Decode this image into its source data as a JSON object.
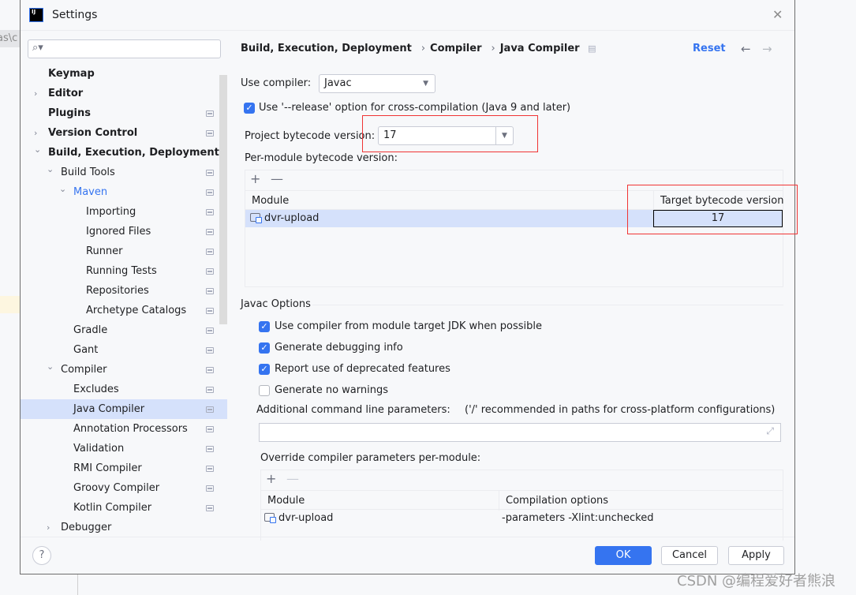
{
  "background": {
    "tab_fragment": "as\\c"
  },
  "window": {
    "title": "Settings",
    "icon_text": "IJ"
  },
  "search": {
    "placeholder": ""
  },
  "tree": [
    {
      "label": "Keymap",
      "level": 0,
      "bold": true,
      "chevron": "",
      "settings": false
    },
    {
      "label": "Editor",
      "level": 0,
      "bold": true,
      "chevron": "right",
      "settings": false
    },
    {
      "label": "Plugins",
      "level": 0,
      "bold": true,
      "chevron": "",
      "settings": true
    },
    {
      "label": "Version Control",
      "level": 0,
      "bold": true,
      "chevron": "right",
      "settings": true
    },
    {
      "label": "Build, Execution, Deployment",
      "level": 0,
      "bold": true,
      "chevron": "down",
      "settings": false
    },
    {
      "label": "Build Tools",
      "level": 1,
      "bold": false,
      "chevron": "down",
      "settings": true
    },
    {
      "label": "Maven",
      "level": 2,
      "bold": false,
      "chevron": "down",
      "settings": true,
      "color": "#3574f0"
    },
    {
      "label": "Importing",
      "level": 3,
      "bold": false,
      "chevron": "",
      "settings": true
    },
    {
      "label": "Ignored Files",
      "level": 3,
      "bold": false,
      "chevron": "",
      "settings": true
    },
    {
      "label": "Runner",
      "level": 3,
      "bold": false,
      "chevron": "",
      "settings": true
    },
    {
      "label": "Running Tests",
      "level": 3,
      "bold": false,
      "chevron": "",
      "settings": true
    },
    {
      "label": "Repositories",
      "level": 3,
      "bold": false,
      "chevron": "",
      "settings": true
    },
    {
      "label": "Archetype Catalogs",
      "level": 3,
      "bold": false,
      "chevron": "",
      "settings": true
    },
    {
      "label": "Gradle",
      "level": 2,
      "bold": false,
      "chevron": "",
      "settings": true
    },
    {
      "label": "Gant",
      "level": 2,
      "bold": false,
      "chevron": "",
      "settings": true
    },
    {
      "label": "Compiler",
      "level": 1,
      "bold": false,
      "chevron": "down",
      "settings": true
    },
    {
      "label": "Excludes",
      "level": 2,
      "bold": false,
      "chevron": "",
      "settings": true
    },
    {
      "label": "Java Compiler",
      "level": 2,
      "bold": false,
      "chevron": "",
      "settings": true,
      "selected": true
    },
    {
      "label": "Annotation Processors",
      "level": 2,
      "bold": false,
      "chevron": "",
      "settings": true
    },
    {
      "label": "Validation",
      "level": 2,
      "bold": false,
      "chevron": "",
      "settings": true
    },
    {
      "label": "RMI Compiler",
      "level": 2,
      "bold": false,
      "chevron": "",
      "settings": true
    },
    {
      "label": "Groovy Compiler",
      "level": 2,
      "bold": false,
      "chevron": "",
      "settings": true
    },
    {
      "label": "Kotlin Compiler",
      "level": 2,
      "bold": false,
      "chevron": "",
      "settings": true
    },
    {
      "label": "Debugger",
      "level": 1,
      "bold": false,
      "chevron": "right",
      "settings": false
    }
  ],
  "breadcrumb": [
    "Build, Execution, Deployment",
    "Compiler",
    "Java Compiler"
  ],
  "header": {
    "reset": "Reset",
    "back": "←",
    "forward": "→"
  },
  "compiler": {
    "label": "Use compiler:",
    "value": "Javac"
  },
  "release_option": {
    "label": "Use '--release' option for cross-compilation (Java 9 and later)",
    "checked": true
  },
  "project_bytecode": {
    "label": "Project bytecode version:",
    "value": "17"
  },
  "per_module": {
    "label": "Per-module bytecode version:",
    "add": "+",
    "remove": "—",
    "col_module": "Module",
    "col_target": "Target bytecode version",
    "rows": [
      {
        "module": "dvr-upload",
        "target": "17"
      }
    ]
  },
  "javac": {
    "section": "Javac Options",
    "options": [
      {
        "label": "Use compiler from module target JDK when possible",
        "checked": true
      },
      {
        "label": "Generate debugging info",
        "checked": true
      },
      {
        "label": "Report use of deprecated features",
        "checked": true
      },
      {
        "label": "Generate no warnings",
        "checked": false
      }
    ],
    "additional_label": "Additional command line parameters:",
    "additional_hint": "('/' recommended in paths for cross-platform configurations)",
    "additional_value": "",
    "override_label": "Override compiler parameters per-module:",
    "add": "+",
    "remove": "—",
    "col_module": "Module",
    "col_options": "Compilation options",
    "override_rows": [
      {
        "module": "dvr-upload",
        "options": "-parameters -Xlint:unchecked"
      }
    ]
  },
  "footer": {
    "help": "?",
    "ok": "OK",
    "cancel": "Cancel",
    "apply": "Apply"
  },
  "watermark": "CSDN @编程爱好者熊浪",
  "colors": {
    "accent": "#3574f0",
    "selection": "#d5e1fb",
    "highlight_box": "#f03434"
  }
}
